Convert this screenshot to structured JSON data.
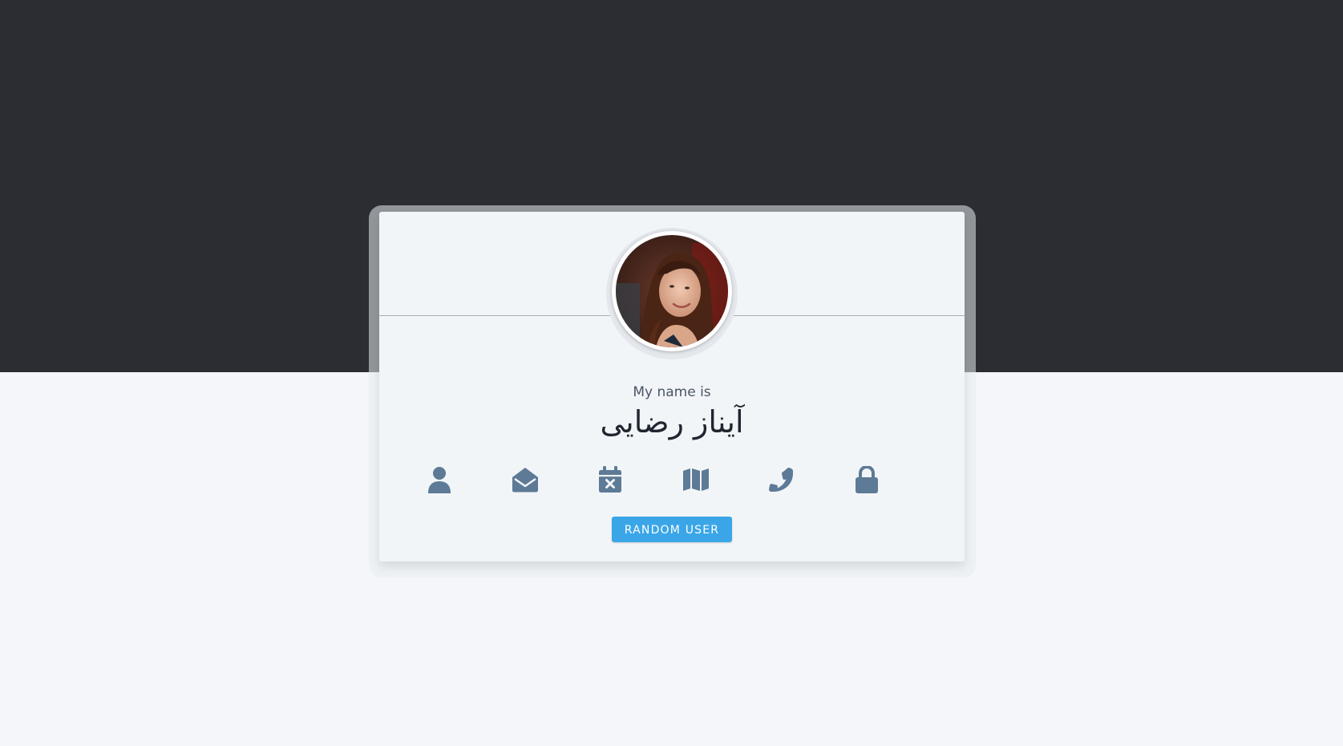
{
  "profile": {
    "label": "My name is",
    "name": "آیناز رضایی"
  },
  "icons": [
    {
      "name": "user-icon"
    },
    {
      "name": "envelope-open-icon"
    },
    {
      "name": "calendar-x-icon"
    },
    {
      "name": "map-icon"
    },
    {
      "name": "phone-icon"
    },
    {
      "name": "lock-icon"
    }
  ],
  "actions": {
    "random_user": "RANDOM USER"
  },
  "colors": {
    "top_band": "#2b2d32",
    "page_background": "#f4f6f9",
    "card_background": "#f2f5f8",
    "icon": "#5d7a96",
    "button": "#3aa6e8",
    "name_text": "#1f2630",
    "label_text": "#4a5563"
  }
}
